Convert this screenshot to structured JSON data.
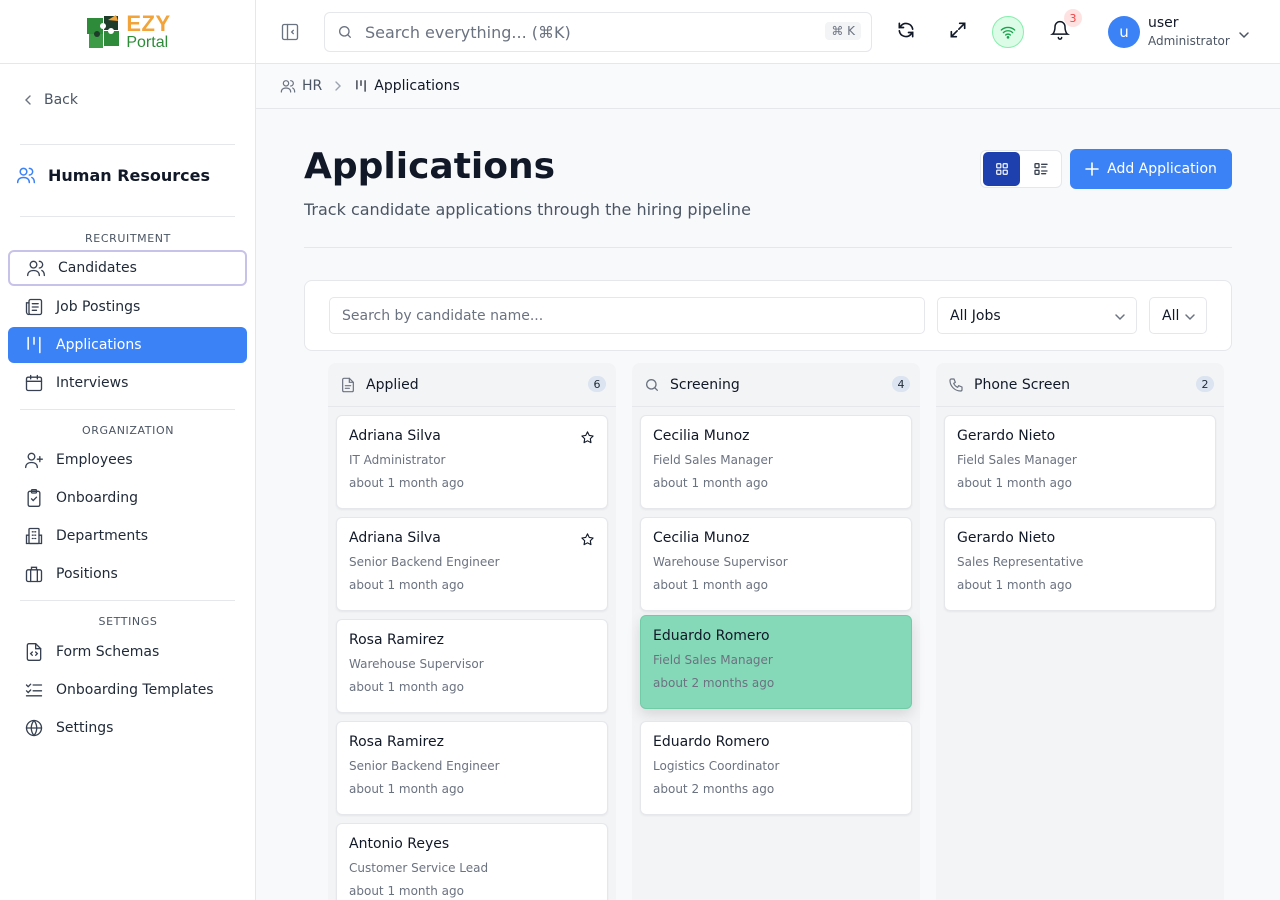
{
  "app": {
    "logo_top": "EZY",
    "logo_bottom": "Portal"
  },
  "sidebar": {
    "back_label": "Back",
    "section_title": "Human Resources",
    "groups": [
      {
        "label": "RECRUITMENT",
        "items": [
          {
            "label": "Candidates",
            "icon": "users-icon"
          },
          {
            "label": "Job Postings",
            "icon": "newspaper-icon"
          },
          {
            "label": "Applications",
            "icon": "kanban-icon"
          },
          {
            "label": "Interviews",
            "icon": "calendar-icon"
          }
        ]
      },
      {
        "label": "ORGANIZATION",
        "items": [
          {
            "label": "Employees",
            "icon": "user-plus-icon"
          },
          {
            "label": "Onboarding",
            "icon": "clipboard-check-icon"
          },
          {
            "label": "Departments",
            "icon": "building-icon"
          },
          {
            "label": "Positions",
            "icon": "briefcase-icon"
          }
        ]
      },
      {
        "label": "SETTINGS",
        "items": [
          {
            "label": "Form Schemas",
            "icon": "file-code-icon"
          },
          {
            "label": "Onboarding Templates",
            "icon": "list-checks-icon"
          },
          {
            "label": "Settings",
            "icon": "globe-icon"
          }
        ]
      }
    ]
  },
  "topbar": {
    "search_placeholder": "Search everything... (⌘K)",
    "search_shortcut": "⌘ K",
    "notification_count": "3",
    "user_initial": "u",
    "user_name": "user",
    "user_role": "Administrator"
  },
  "breadcrumb": {
    "parent": "HR",
    "current": "Applications"
  },
  "page": {
    "title": "Applications",
    "subtitle": "Track candidate applications through the hiring pipeline",
    "add_button": "Add Application"
  },
  "filters": {
    "search_placeholder": "Search by candidate name...",
    "job_select": "All Jobs",
    "status_select": "All"
  },
  "columns": [
    {
      "title": "Applied",
      "icon": "file-icon",
      "count": "6",
      "cards": [
        {
          "name": "Adriana Silva",
          "role": "IT Administrator",
          "time": "about 1 month ago",
          "star": true
        },
        {
          "name": "Adriana Silva",
          "role": "Senior Backend Engineer",
          "time": "about 1 month ago",
          "star": true
        },
        {
          "name": "Rosa Ramirez",
          "role": "Warehouse Supervisor",
          "time": "about 1 month ago"
        },
        {
          "name": "Rosa Ramirez",
          "role": "Senior Backend Engineer",
          "time": "about 1 month ago"
        },
        {
          "name": "Antonio Reyes",
          "role": "Customer Service Lead",
          "time": "about 1 month ago"
        }
      ]
    },
    {
      "title": "Screening",
      "icon": "search-icon",
      "count": "4",
      "cards": [
        {
          "name": "Cecilia Munoz",
          "role": "Field Sales Manager",
          "time": "about 1 month ago"
        },
        {
          "name": "Cecilia Munoz",
          "role": "Warehouse Supervisor",
          "time": "about 1 month ago"
        },
        {
          "name": "Eduardo Romero",
          "role": "Field Sales Manager",
          "time": "about 2 months ago",
          "highlight": true
        },
        {
          "name": "Eduardo Romero",
          "role": "Logistics Coordinator",
          "time": "about 2 months ago"
        }
      ]
    },
    {
      "title": "Phone Screen",
      "icon": "phone-icon",
      "count": "2",
      "cards": [
        {
          "name": "Gerardo Nieto",
          "role": "Field Sales Manager",
          "time": "about 1 month ago"
        },
        {
          "name": "Gerardo Nieto",
          "role": "Sales Representative",
          "time": "about 1 month ago"
        }
      ]
    }
  ],
  "colors": {
    "accent": "#3b82f6",
    "highlight_card": "#86d9b8",
    "logo_orange": "#f2a33a",
    "logo_green": "#2e8b3a"
  }
}
